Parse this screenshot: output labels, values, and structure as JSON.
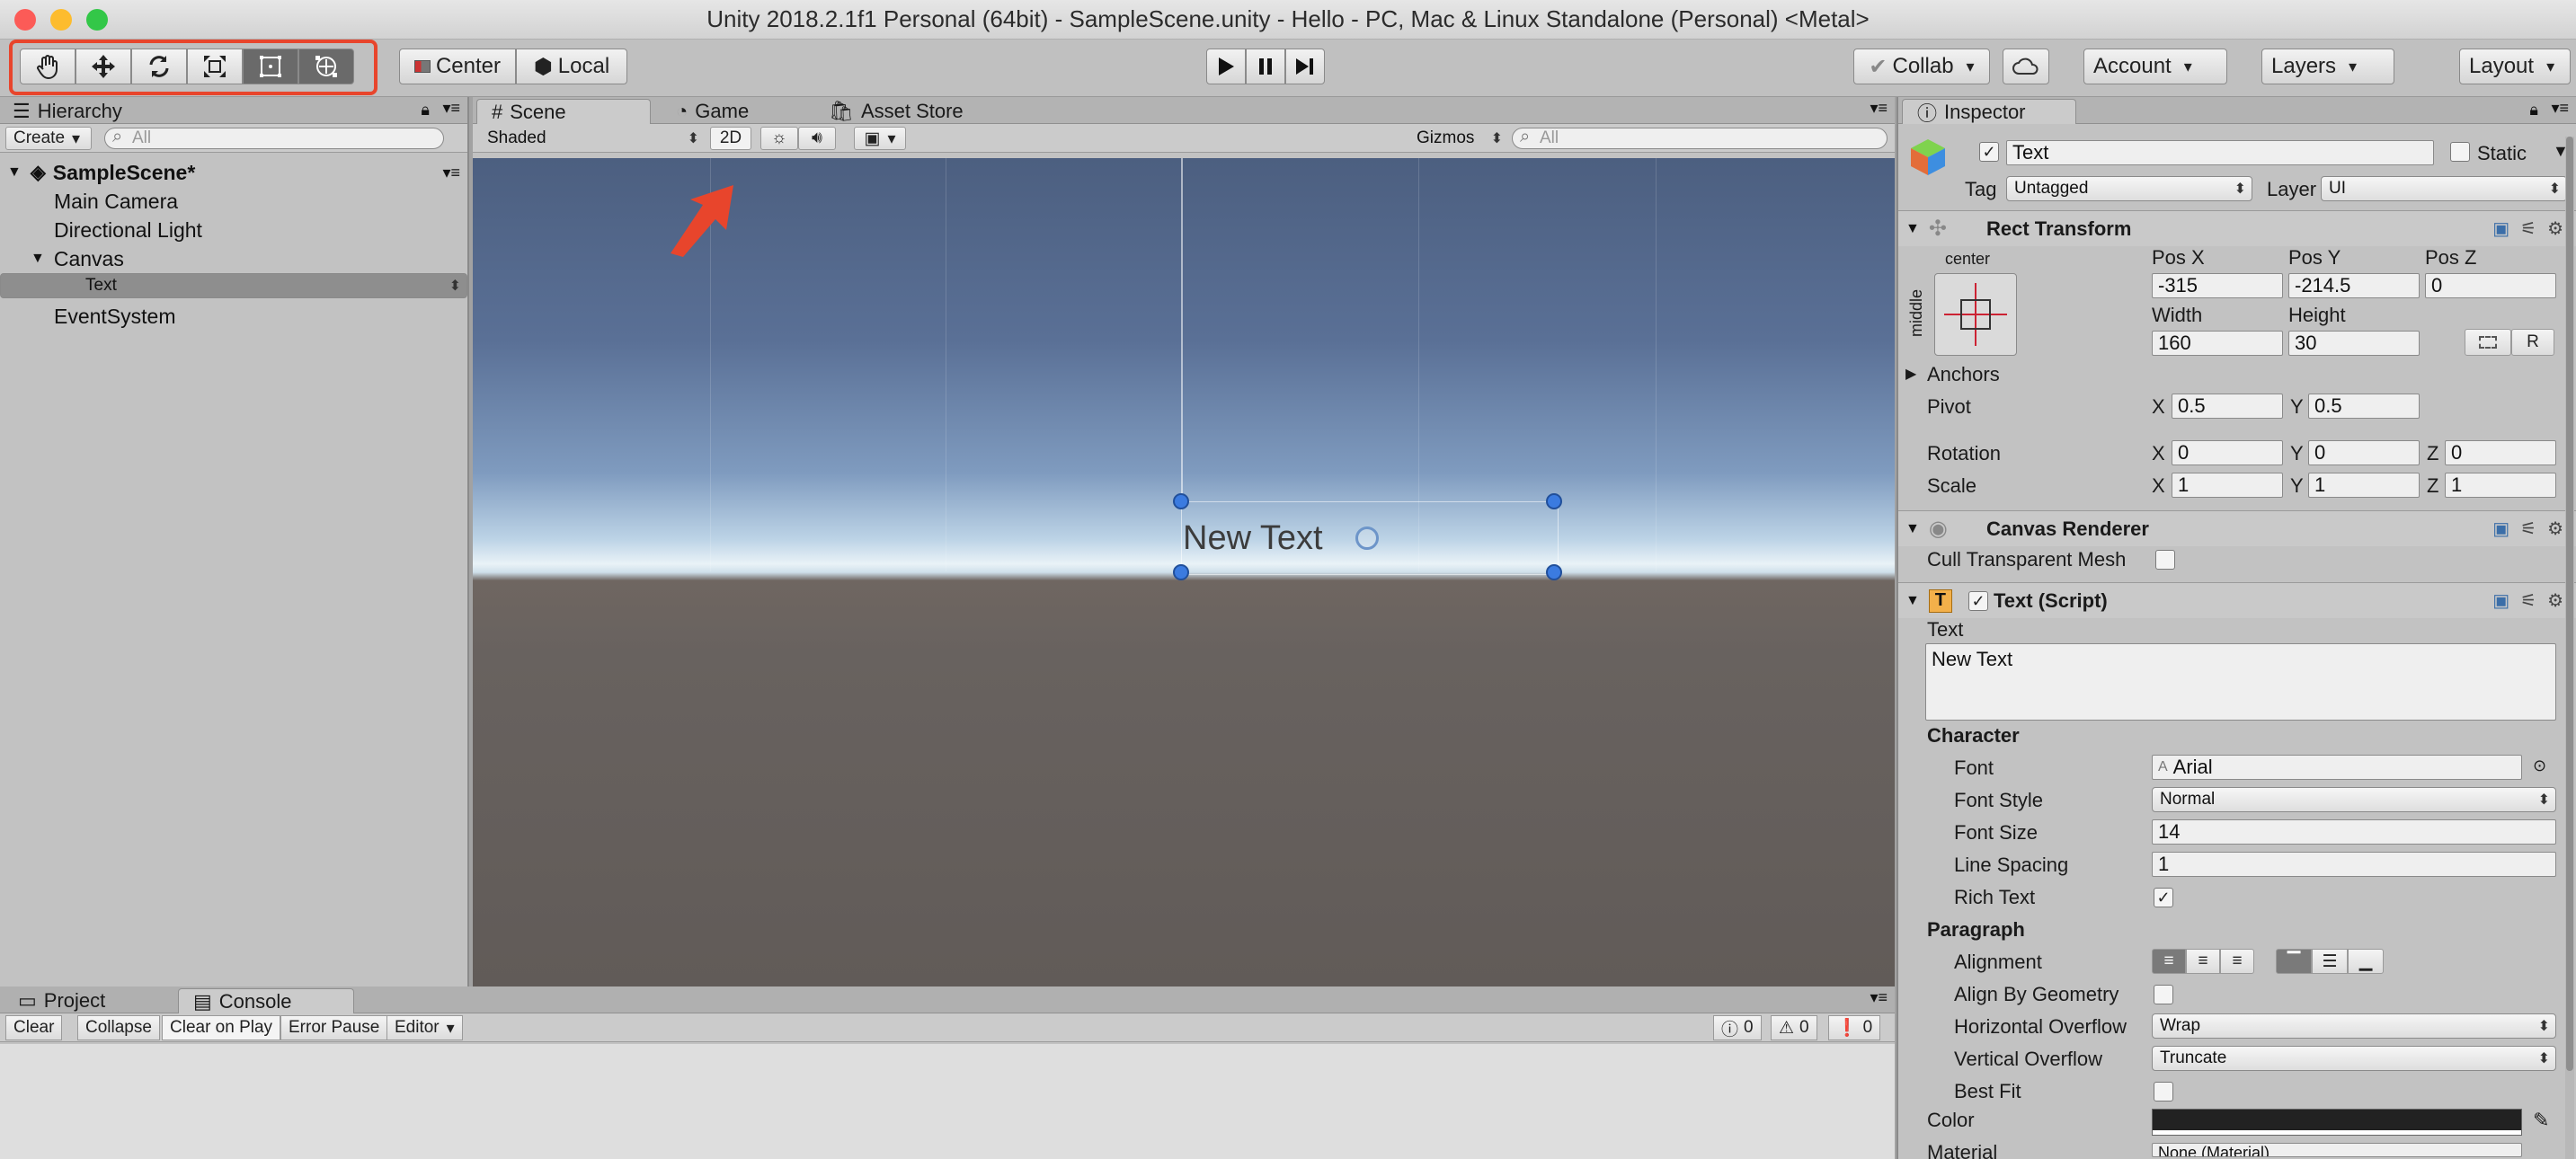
{
  "window": {
    "title": "Unity 2018.2.1f1 Personal (64bit) - SampleScene.unity - Hello - PC, Mac & Linux Standalone (Personal) <Metal>"
  },
  "toolbar": {
    "tools": [
      "hand-tool",
      "move-tool",
      "rotate-tool",
      "scale-tool",
      "rect-tool",
      "transform-tool"
    ],
    "center_label": "Center",
    "local_label": "Local",
    "collab_label": "Collab",
    "account_label": "Account",
    "layers_label": "Layers",
    "layout_label": "Layout"
  },
  "hierarchy": {
    "tab_label": "Hierarchy",
    "create_label": "Create",
    "search_placeholder": "All",
    "scene_name": "SampleScene*",
    "items": [
      "Main Camera",
      "Directional Light",
      "Canvas",
      "Text",
      "EventSystem"
    ]
  },
  "scene": {
    "tabs": [
      "Scene",
      "Game",
      "Asset Store"
    ],
    "shading_mode": "Shaded",
    "mode_2d": "2D",
    "gizmos_label": "Gizmos",
    "search_placeholder": "All",
    "canvas_text": "New Text"
  },
  "console": {
    "tabs": [
      "Project",
      "Console"
    ],
    "buttons": [
      "Clear",
      "Collapse",
      "Clear on Play",
      "Error Pause",
      "Editor"
    ],
    "info_count": "0",
    "warning_count": "0",
    "error_count": "0"
  },
  "inspector": {
    "tab_label": "Inspector",
    "object_name": "Text",
    "static_label": "Static",
    "tag_label": "Tag",
    "tag_value": "Untagged",
    "layer_label": "Layer",
    "layer_value": "UI",
    "rect_transform": {
      "title": "Rect Transform",
      "anchor_h": "center",
      "anchor_v": "middle",
      "pos_x_label": "Pos X",
      "pos_x": "-315",
      "pos_y_label": "Pos Y",
      "pos_y": "-214.5",
      "pos_z_label": "Pos Z",
      "pos_z": "0",
      "width_label": "Width",
      "width": "160",
      "height_label": "Height",
      "height": "30",
      "r_button": "R",
      "anchors_label": "Anchors",
      "pivot_label": "Pivot",
      "pivot_x": "0.5",
      "pivot_y": "0.5",
      "rotation_label": "Rotation",
      "rot_x": "0",
      "rot_y": "0",
      "rot_z": "0",
      "scale_label": "Scale",
      "scale_x": "1",
      "scale_y": "1",
      "scale_z": "1",
      "x": "X",
      "y": "Y",
      "z": "Z"
    },
    "canvas_renderer": {
      "title": "Canvas Renderer",
      "cull_label": "Cull Transparent Mesh"
    },
    "text_script": {
      "title": "Text (Script)",
      "text_label": "Text",
      "text_value": "New Text",
      "character_label": "Character",
      "font_label": "Font",
      "font_value": "Arial",
      "font_style_label": "Font Style",
      "font_style_value": "Normal",
      "font_size_label": "Font Size",
      "font_size_value": "14",
      "line_spacing_label": "Line Spacing",
      "line_spacing_value": "1",
      "rich_text_label": "Rich Text",
      "paragraph_label": "Paragraph",
      "alignment_label": "Alignment",
      "align_geometry_label": "Align By Geometry",
      "h_overflow_label": "Horizontal Overflow",
      "h_overflow_value": "Wrap",
      "v_overflow_label": "Vertical Overflow",
      "v_overflow_value": "Truncate",
      "best_fit_label": "Best Fit",
      "color_label": "Color",
      "material_label": "Material",
      "material_value": "None (Material)"
    }
  },
  "colors": {
    "highlight": "#e8452c",
    "selection": "#3b7be0"
  }
}
